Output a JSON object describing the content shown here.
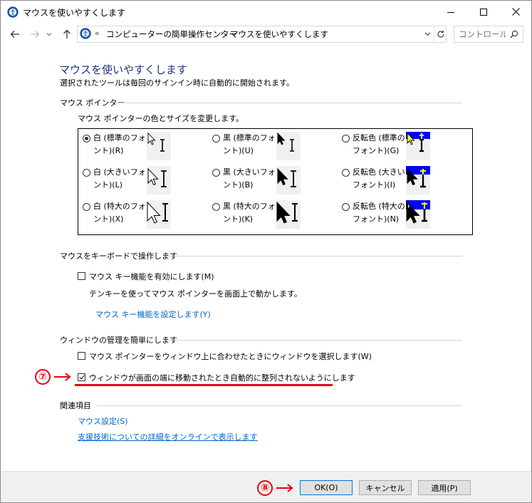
{
  "window": {
    "title": "マウスを使いやすくします",
    "controls": {
      "minimize": "minimize",
      "maximize": "maximize",
      "close": "close"
    }
  },
  "address": {
    "overflow": "«",
    "crumbs": [
      "コンピューターの簡単操作センター",
      "マウスを使いやすくします"
    ],
    "search_placeholder": "コントロール..."
  },
  "page": {
    "title": "マウスを使いやすくします",
    "subtitle": "選択されたツールは毎回のサインイン時に自動的に開始されます。"
  },
  "pointer_section": {
    "heading": "マウス ポインター",
    "description": "マウス ポインターの色とサイズを変更します。",
    "options": [
      {
        "label": "白 (標準のフォント)(R)",
        "scheme": "white",
        "size": "small",
        "selected": true
      },
      {
        "label": "黒 (標準のフォント)(U)",
        "scheme": "black",
        "size": "small",
        "selected": false
      },
      {
        "label": "反転色 (標準のフォント)(G)",
        "scheme": "invert",
        "size": "small",
        "selected": false
      },
      {
        "label": "白 (大きいフォント)(L)",
        "scheme": "white",
        "size": "large",
        "selected": false
      },
      {
        "label": "黒 (大きいフォント)(B)",
        "scheme": "black",
        "size": "large",
        "selected": false
      },
      {
        "label": "反転色 (大きいフォント)(I)",
        "scheme": "invert",
        "size": "large",
        "selected": false
      },
      {
        "label": "白 (特大のフォント)(X)",
        "scheme": "white",
        "size": "xlarge",
        "selected": false
      },
      {
        "label": "黒 (特大のフォント)(K)",
        "scheme": "black",
        "size": "xlarge",
        "selected": false
      },
      {
        "label": "反転色 (特大のフォント)(N)",
        "scheme": "invert",
        "size": "xlarge",
        "selected": false
      }
    ]
  },
  "keyboard_section": {
    "heading": "マウスをキーボードで操作します",
    "mouse_keys_label": "マウス キー機能を有効にします(M)",
    "mouse_keys_checked": false,
    "mouse_keys_description": "テンキーを使ってマウス ポインターを画面上で動かします。",
    "setup_link": "マウス キー機能を設定します(Y)"
  },
  "window_section": {
    "heading": "ウィンドウの管理を簡単にします",
    "hover_label": "マウス ポインターをウィンドウ上に合わせたときにウィンドウを選択します(W)",
    "hover_checked": false,
    "snap_label": "ウィンドウが画面の端に移動されたとき自動的に整列されないようにします",
    "snap_checked": true
  },
  "related": {
    "heading": "関連項目",
    "links": [
      "マウス設定(S)",
      "支援技術についての詳細をオンラインで表示します"
    ]
  },
  "annotations": {
    "step7": "⑦",
    "step8": "⑧",
    "color": "#e60012"
  },
  "buttons": {
    "ok": "OK(O)",
    "cancel": "キャンセル",
    "apply": "適用(P)"
  },
  "colors": {
    "title_blue": "#1e3287",
    "link_blue": "#0066cc",
    "invert_blue": "#0000ff",
    "invert_yellow": "#ffff00"
  }
}
